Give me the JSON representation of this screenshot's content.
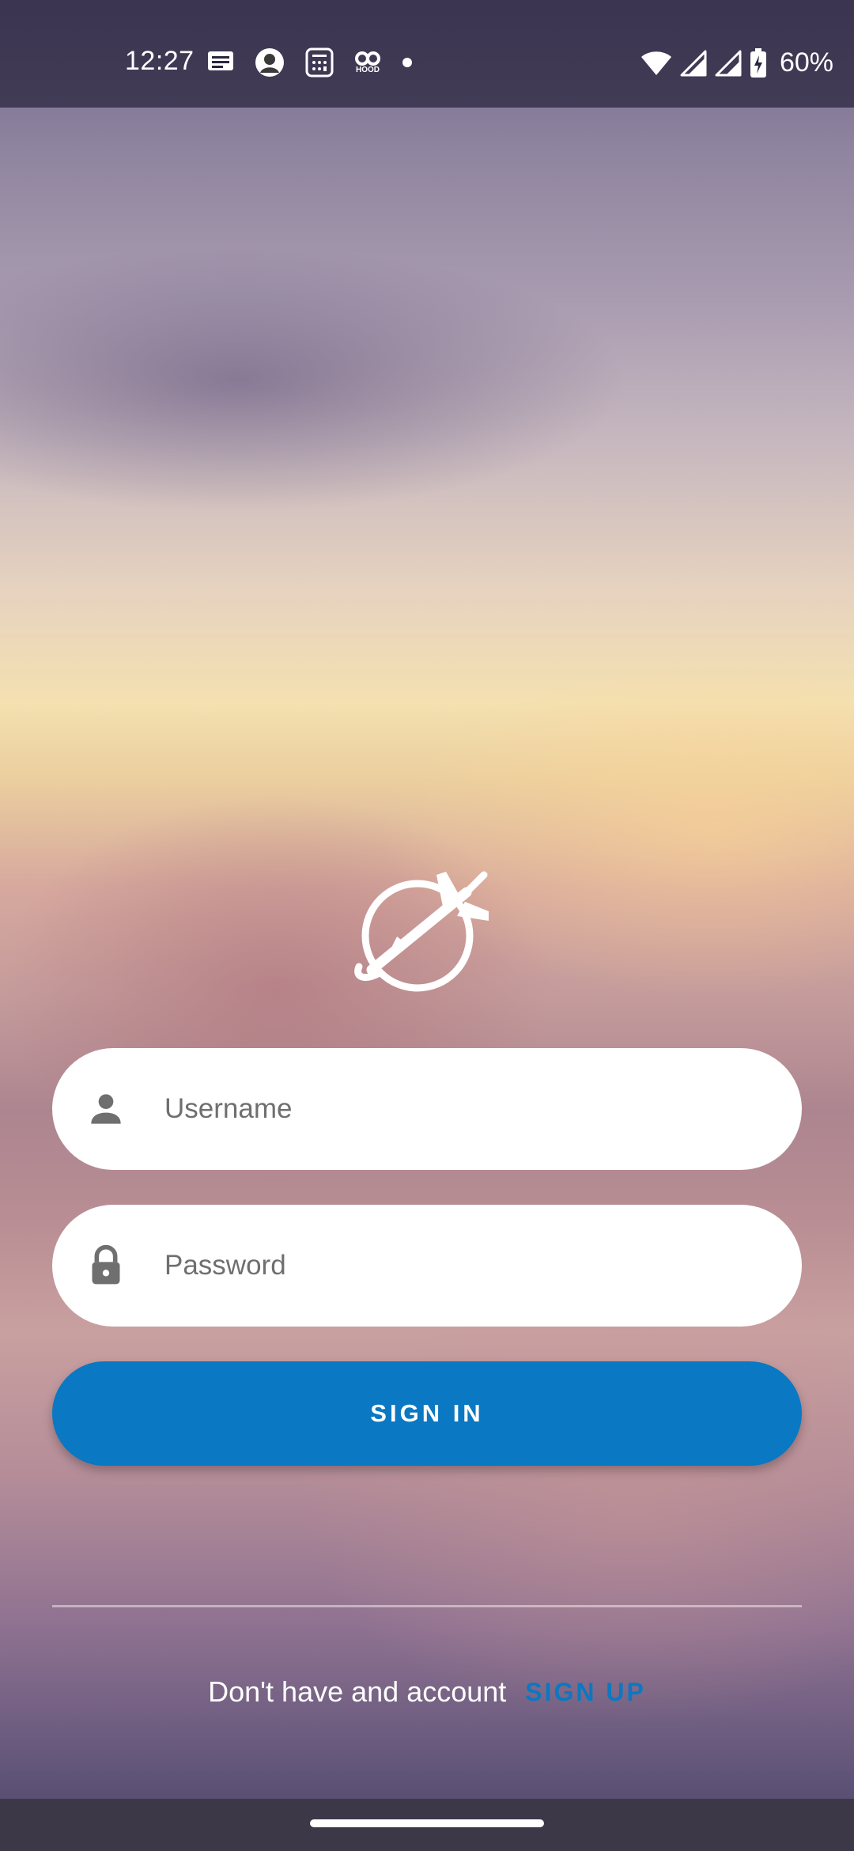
{
  "status_bar": {
    "time": "12:27",
    "battery": "60%",
    "left_icons": [
      "message-icon",
      "avatar-icon",
      "calculator-icon",
      "hood-app-icon",
      "dot-icon"
    ],
    "right_icons": [
      "wifi-icon",
      "signal-icon",
      "signal-icon",
      "battery-charging-icon"
    ],
    "hood_label": "HOOD"
  },
  "login": {
    "logo_icon": "plane-globe-logo",
    "username_placeholder": "Username",
    "password_placeholder": "Password",
    "username_icon": "person-icon",
    "password_icon": "lock-icon",
    "sign_in_label": "SIGN IN"
  },
  "footer": {
    "prompt": "Don't have and account",
    "sign_up_label": "SIGN UP"
  },
  "colors": {
    "accent": "#0a78c2",
    "field_bg": "#ffffff",
    "icon_gray": "#6f6f6f"
  }
}
